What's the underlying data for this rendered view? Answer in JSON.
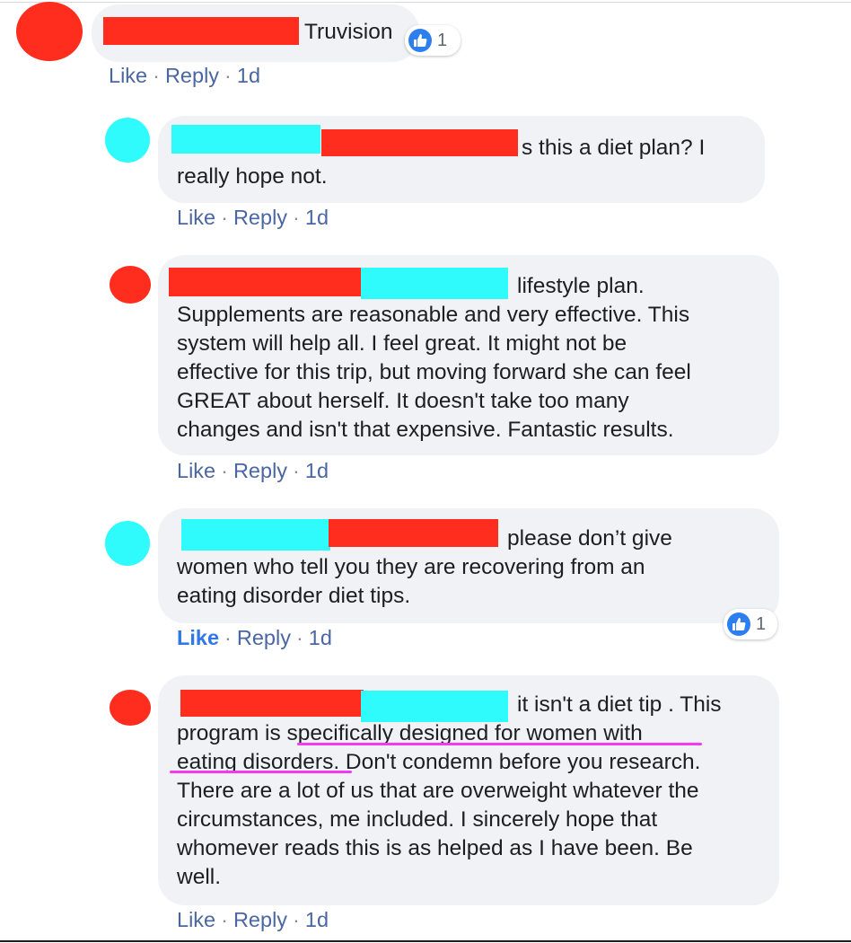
{
  "comments": [
    {
      "text": "Truvision",
      "actions": {
        "like": "Like",
        "reply": "Reply",
        "time": "1d"
      },
      "reactions": "1",
      "colors": {
        "avatar": "#ff2d1e",
        "redaction": [
          "#ff2d1e"
        ]
      }
    },
    {
      "text": "s this a diet plan? I\nreally hope not.",
      "actions": {
        "like": "Like",
        "reply": "Reply",
        "time": "1d"
      },
      "colors": {
        "avatar": "#2ffbfd",
        "redaction": [
          "#2ffbfd",
          "#ff2d1e"
        ]
      }
    },
    {
      "text": "lifestyle plan.\nSupplements are reasonable and very effective. This\nsystem will help all. I feel great. It might not be\neffective for this trip, but moving forward she can feel\nGREAT about herself. It doesn't take too many\nchanges and isn't that expensive. Fantastic results.",
      "actions": {
        "like": "Like",
        "reply": "Reply",
        "time": "1d"
      },
      "colors": {
        "avatar": "#ff2d1e",
        "redaction": [
          "#ff2d1e",
          "#2ffbfd"
        ]
      }
    },
    {
      "text": "please don’t give\nwomen who tell you they are recovering from an\neating disorder diet tips.",
      "actions": {
        "like": "Like",
        "reply": "Reply",
        "time": "1d"
      },
      "liked": true,
      "reactions": "1",
      "colors": {
        "avatar": "#2ffbfd",
        "redaction": [
          "#2ffbfd",
          "#ff2d1e"
        ]
      }
    },
    {
      "text": "it isn't a diet tip . This\nprogram is specifically designed for women with\neating disorders. Don't condemn before you research.\nThere are a lot of us that are overweight whatever the\ncircumstances, me included. I sincerely hope that\nwhomever reads this is as helped as I have been. Be\nwell.",
      "actions": {
        "like": "Like",
        "reply": "Reply",
        "time": "1d"
      },
      "highlight_color": "#f23bf0",
      "colors": {
        "avatar": "#ff2d1e",
        "redaction": [
          "#ff2d1e",
          "#2ffbfd"
        ]
      }
    }
  ],
  "icons": {
    "reaction": "thumbs-up-icon"
  },
  "accent": "#4b67a1",
  "liked_color": "#2f77ea"
}
